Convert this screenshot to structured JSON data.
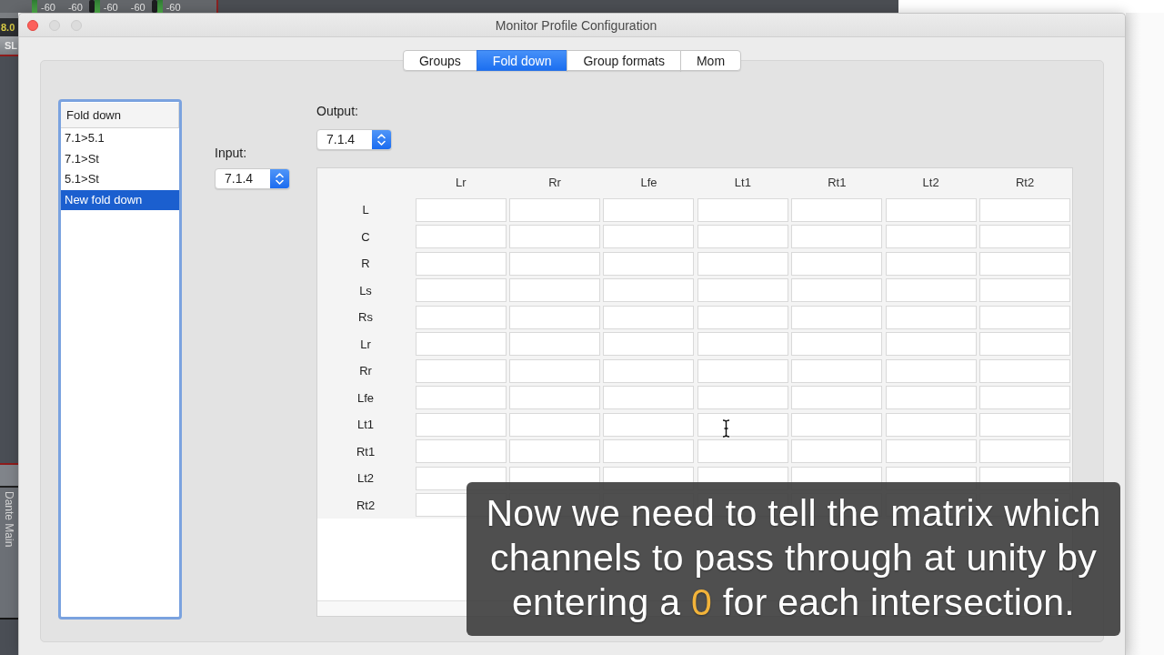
{
  "mixer_background": {
    "meter_readings": [
      "-60",
      "-60",
      "-60",
      "-60",
      "-60"
    ],
    "strip_value": "8.0",
    "strip_label": "SL",
    "track_name": "Dante Main"
  },
  "window": {
    "title": "Monitor Profile Configuration"
  },
  "tabs": [
    {
      "label": "Groups",
      "selected": false
    },
    {
      "label": "Fold down",
      "selected": true
    },
    {
      "label": "Group formats",
      "selected": false
    },
    {
      "label": "Mom",
      "selected": false
    }
  ],
  "fold_down_list": {
    "header": "Fold down",
    "items": [
      {
        "label": "7.1>5.1",
        "selected": false
      },
      {
        "label": "7.1>St",
        "selected": false
      },
      {
        "label": "5.1>St",
        "selected": false
      },
      {
        "label": "New fold down",
        "selected": true
      }
    ]
  },
  "input": {
    "label": "Input:",
    "value": "7.1.4"
  },
  "output": {
    "label": "Output:",
    "value": "7.1.4"
  },
  "matrix": {
    "columns": [
      "Lr",
      "Rr",
      "Lfe",
      "Lt1",
      "Rt1",
      "Lt2",
      "Rt2"
    ],
    "rows": [
      "L",
      "C",
      "R",
      "Ls",
      "Rs",
      "Lr",
      "Rr",
      "Lfe",
      "Lt1",
      "Rt1",
      "Lt2",
      "Rt2"
    ]
  },
  "caption": {
    "parts": [
      {
        "text": "Now we need to tell the matrix which channels to pass through at unity by entering a ",
        "highlight": false
      },
      {
        "text": "0",
        "highlight": true
      },
      {
        "text": " for each intersection.",
        "highlight": false
      }
    ]
  }
}
